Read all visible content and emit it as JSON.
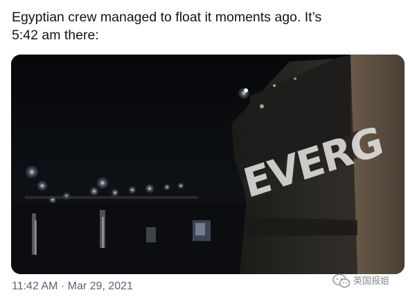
{
  "tweet": {
    "text": "Egyptian crew managed to float it moments ago. It’s\n5:42 am there:"
  },
  "media": {
    "hull_text": "EVERG"
  },
  "meta": {
    "time": "11:42 AM",
    "separator": "·",
    "date": "Mar 29, 2021"
  },
  "watermark": {
    "text": "英国报姐"
  }
}
